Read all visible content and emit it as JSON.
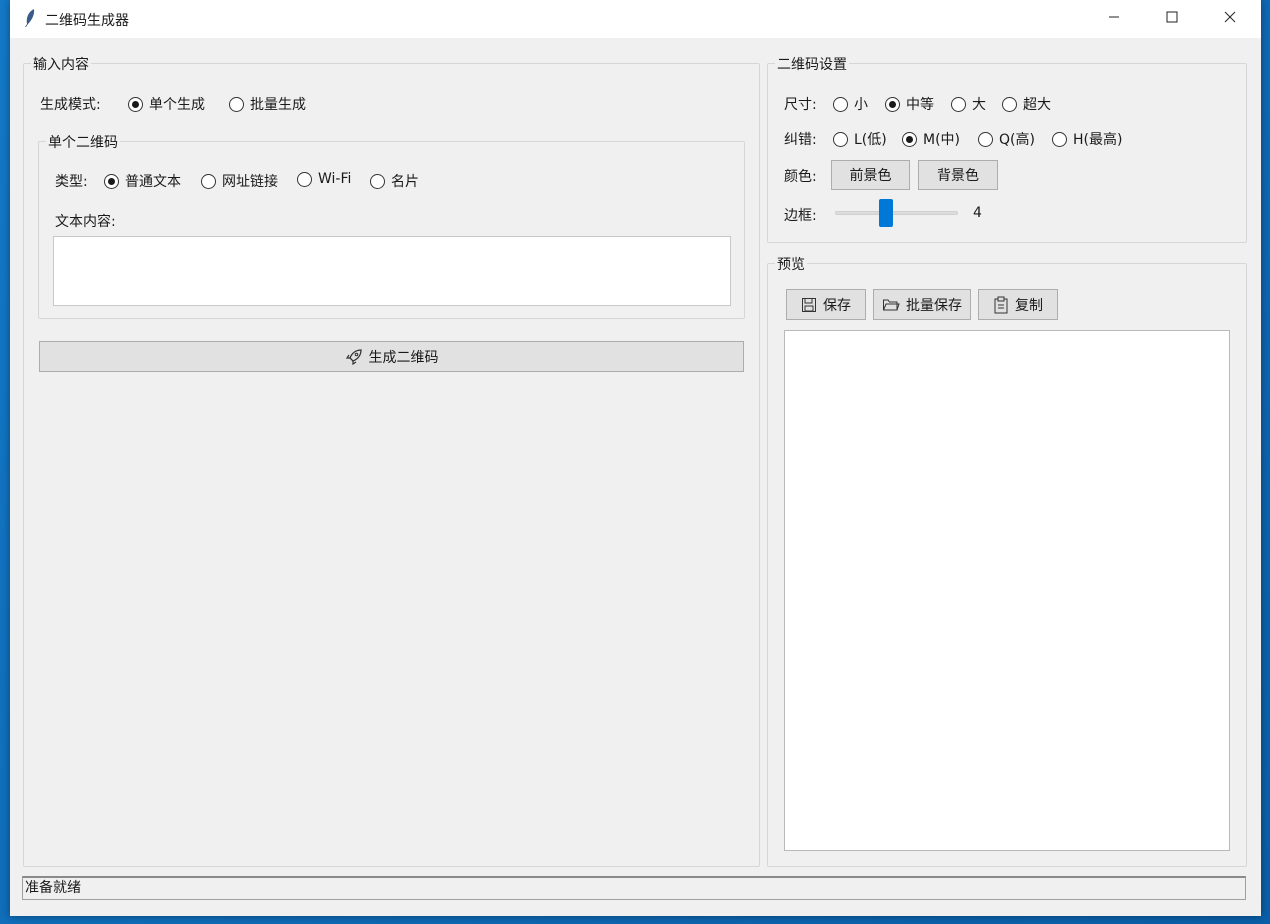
{
  "window": {
    "title": "二维码生成器",
    "controls": {
      "minimize": "minimize-icon",
      "maximize": "maximize-icon",
      "close": "close-icon"
    }
  },
  "input_group": {
    "legend": "输入内容",
    "mode_label": "生成模式:",
    "mode_options": [
      {
        "label": "单个生成",
        "selected": true
      },
      {
        "label": "批量生成",
        "selected": false
      }
    ],
    "single": {
      "legend": "单个二维码",
      "type_label": "类型:",
      "type_options": [
        {
          "label": "普通文本",
          "selected": true
        },
        {
          "label": "网址链接",
          "selected": false
        },
        {
          "label": "Wi-Fi",
          "selected": false
        },
        {
          "label": "名片",
          "selected": false
        }
      ],
      "content_label": "文本内容:",
      "content_value": ""
    },
    "generate_button": "生成二维码",
    "generate_icon": "rocket-icon"
  },
  "settings_group": {
    "legend": "二维码设置",
    "size_label": "尺寸:",
    "size_options": [
      {
        "label": "小",
        "selected": false
      },
      {
        "label": "中等",
        "selected": true
      },
      {
        "label": "大",
        "selected": false
      },
      {
        "label": "超大",
        "selected": false
      }
    ],
    "ecc_label": "纠错:",
    "ecc_options": [
      {
        "label": "L(低)",
        "selected": false
      },
      {
        "label": "M(中)",
        "selected": true
      },
      {
        "label": "Q(高)",
        "selected": false
      },
      {
        "label": "H(最高)",
        "selected": false
      }
    ],
    "color_label": "颜色:",
    "fg_button": "前景色",
    "bg_button": "背景色",
    "border_label": "边框:",
    "border_value": "4",
    "border_slider_fraction": 0.4
  },
  "preview_group": {
    "legend": "预览",
    "save_button": "保存",
    "batch_save_button": "批量保存",
    "copy_button": "复制"
  },
  "status": {
    "text": "准备就绪"
  },
  "colors": {
    "accent": "#0078d7",
    "window_bg": "#f0f0f0",
    "button_bg": "#e1e1e1"
  }
}
